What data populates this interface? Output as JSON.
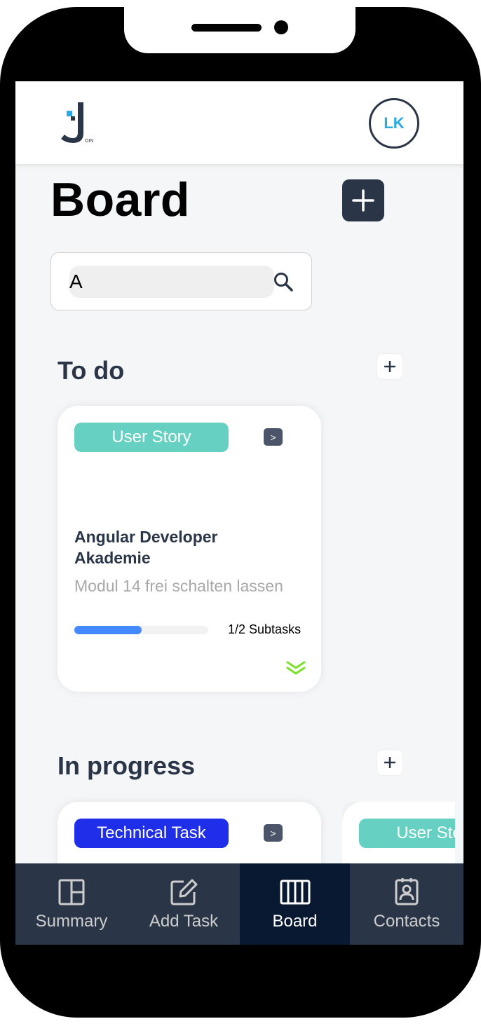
{
  "header": {
    "logo_text": "OIN",
    "avatar_initials": "LK"
  },
  "board": {
    "title": "Board"
  },
  "search": {
    "value": "A"
  },
  "columns": [
    {
      "title": "To do",
      "cards": [
        {
          "tag": "User Story",
          "move_label": ">",
          "title": "Angular Developer Akademie",
          "description": "Modul 14 frei schalten lassen",
          "progress": 0.5,
          "subtasks": "1/2 Subtasks",
          "priority_icon": "low-priority-icon"
        }
      ]
    },
    {
      "title": "In progress",
      "cards": [
        {
          "tag": "Technical Task",
          "move_label": ">"
        },
        {
          "tag": "User Story"
        }
      ]
    }
  ],
  "nav": {
    "items": [
      {
        "label": "Summary",
        "icon": "summary-icon"
      },
      {
        "label": "Add Task",
        "icon": "edit-icon"
      },
      {
        "label": "Board",
        "icon": "board-icon",
        "active": true
      },
      {
        "label": "Contacts",
        "icon": "contacts-icon"
      }
    ]
  },
  "colors": {
    "primary": "#2a3647",
    "nav_active": "#091931",
    "user_story": "#66d1c2",
    "technical_task": "#1f2fe9",
    "progress": "#4589ff",
    "avatar_text": "#29abe2",
    "priority_low": "#7ae229"
  }
}
